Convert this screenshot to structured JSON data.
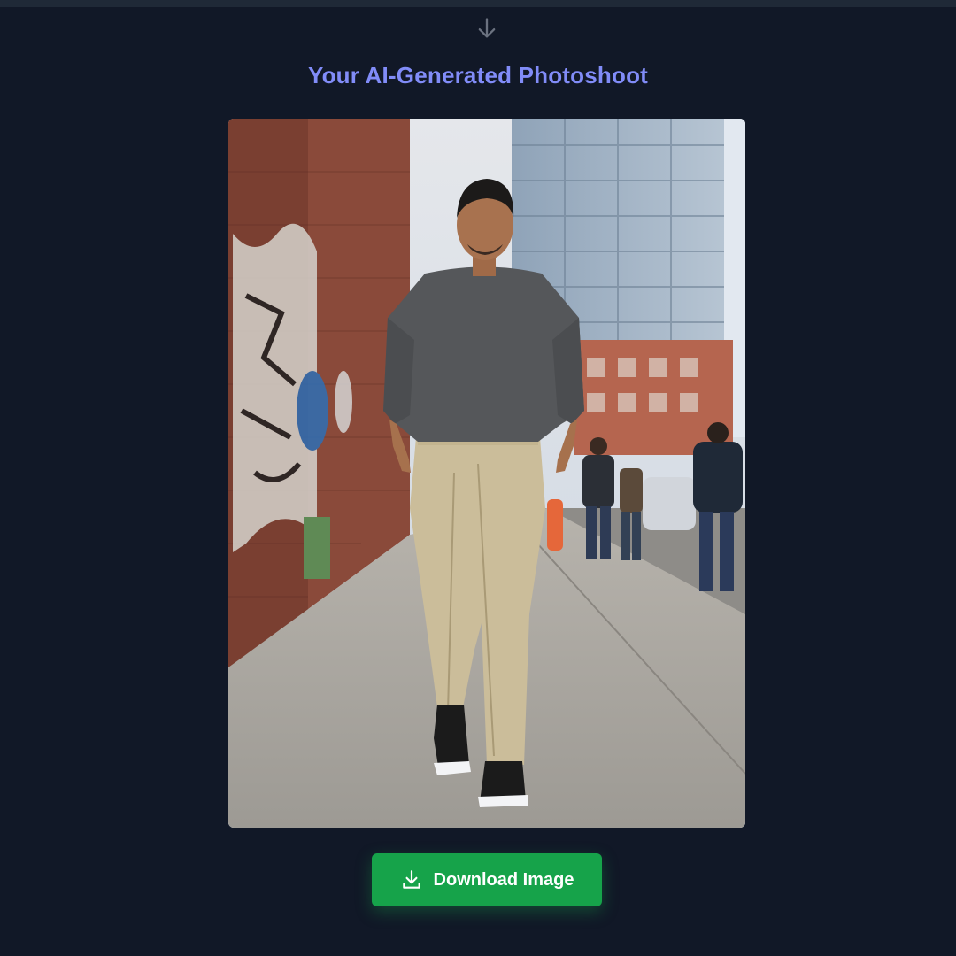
{
  "header": {
    "title": "Your AI-Generated Photoshoot"
  },
  "icons": {
    "flow_arrow": "arrow-down-icon",
    "download": "download-icon"
  },
  "image": {
    "description_alt": "Generated street photoshoot"
  },
  "actions": {
    "download_label": "Download Image"
  },
  "colors": {
    "background": "#111827",
    "title": "#818cf8",
    "button": "#16a34a",
    "button_text": "#ffffff"
  }
}
